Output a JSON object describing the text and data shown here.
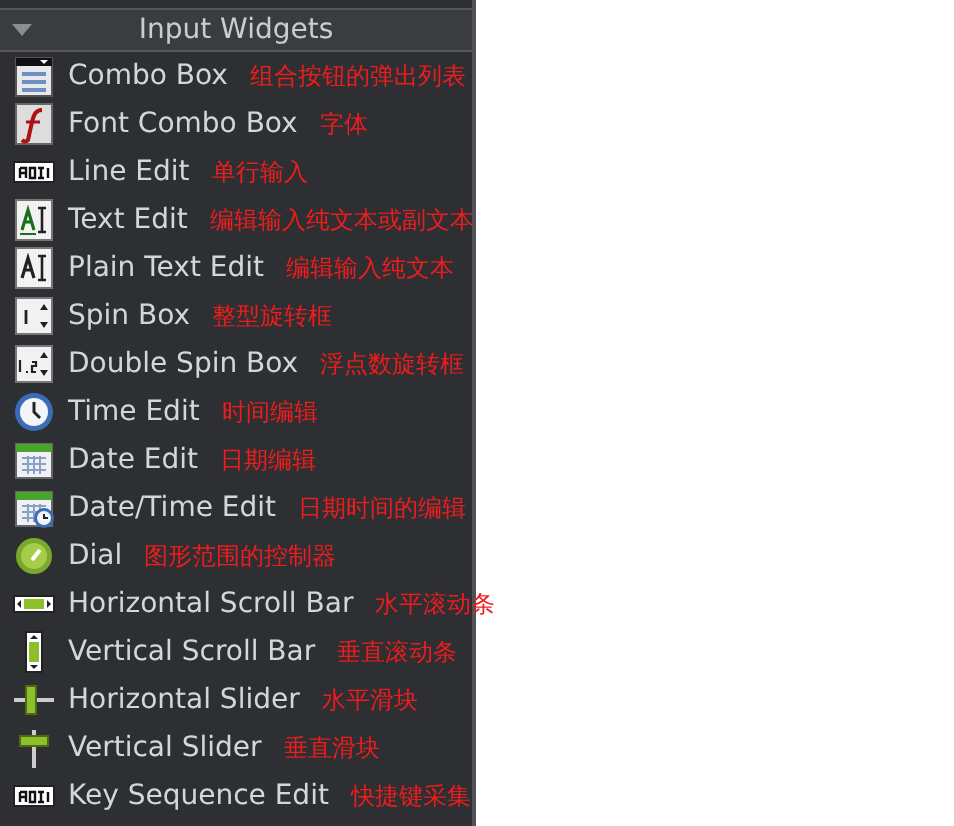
{
  "panel": {
    "title": "Input Widgets",
    "expanded": true,
    "items": [
      {
        "kind": "combo",
        "label": "Combo Box",
        "note": "组合按钮的弹出列表"
      },
      {
        "kind": "font",
        "label": "Font Combo Box",
        "note": "字体"
      },
      {
        "kind": "line",
        "label": "Line Edit",
        "note": "单行输入"
      },
      {
        "kind": "text",
        "label": "Text Edit",
        "note": "编辑输入纯文本或副文本"
      },
      {
        "kind": "plain",
        "label": "Plain Text Edit",
        "note": "编辑输入纯文本"
      },
      {
        "kind": "spin",
        "label": "Spin Box",
        "note": "整型旋转框"
      },
      {
        "kind": "dspin",
        "label": "Double Spin Box",
        "note": "浮点数旋转框"
      },
      {
        "kind": "clock",
        "label": "Time Edit",
        "note": "时间编辑"
      },
      {
        "kind": "calendar",
        "label": "Date Edit",
        "note": "日期编辑"
      },
      {
        "kind": "datetime",
        "label": "Date/Time Edit",
        "note": "日期时间的编辑"
      },
      {
        "kind": "dial",
        "label": "Dial",
        "note": "图形范围的控制器"
      },
      {
        "kind": "hscroll",
        "label": "Horizontal Scroll Bar",
        "note": "水平滚动条"
      },
      {
        "kind": "vscroll",
        "label": "Vertical Scroll Bar",
        "note": "垂直滚动条"
      },
      {
        "kind": "hslider",
        "label": "Horizontal Slider",
        "note": "水平滑块"
      },
      {
        "kind": "vslider",
        "label": "Vertical Slider",
        "note": "垂直滑块"
      },
      {
        "kind": "line",
        "label": "Key Sequence Edit",
        "note": "快捷键采集"
      }
    ]
  }
}
